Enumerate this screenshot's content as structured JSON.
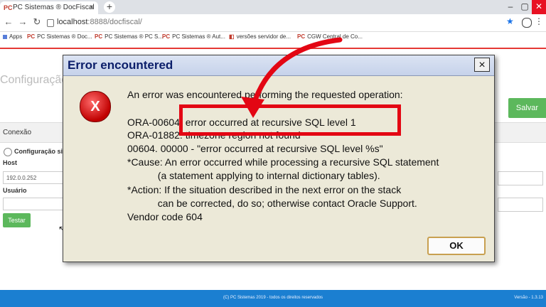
{
  "browser": {
    "tab_title": "PC Sistemas ® DocFiscal",
    "favicon": "PC",
    "tab_close": "×",
    "new_tab": "+",
    "url_host": "localhost",
    "url_path": ":8888/docfiscal/",
    "bookmarks": [
      "Apps",
      "PC Sistemas ® Doc...",
      "PC Sistemas ® PC S...",
      "PC Sistemas ® Aut...",
      "versões servidor de...",
      "CGW Central de Co..."
    ]
  },
  "page": {
    "heading": "Configuração",
    "save_label": "Salvar",
    "section_label": "Conexão",
    "radio_label": "Configuração sim",
    "host_label": "Host",
    "host_value": "192.0.0.252",
    "user_label": "Usuário",
    "test_label": "Testar",
    "footer_text": "(C) PC Sistemas 2019 - todos os direitos reservados",
    "footer_version": "Versão - 1.3.13"
  },
  "dialog": {
    "title": "Error encountered",
    "close": "×",
    "icon_text": "X",
    "lines": [
      "An error was encountered performing the requested operation:",
      "ORA-00604: error occurred at recursive SQL level 1",
      "ORA-01882: timezone region not found",
      "00604. 00000 -  \"error occurred at recursive SQL level %s\"",
      "*Cause:    An error occurred while processing a recursive SQL statement",
      "           (a statement applying to internal dictionary tables).",
      "*Action:   If the situation described in the next error on the stack",
      "           can be corrected, do so; otherwise contact Oracle Support.",
      "Vendor code 604"
    ],
    "ok_label": "OK"
  },
  "colors": {
    "highlight": "#e30613",
    "accent_green": "#5cb85c",
    "footer_blue": "#1b7fd1"
  }
}
